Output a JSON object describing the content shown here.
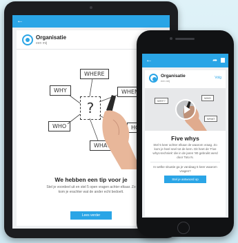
{
  "tablet": {
    "back_icon": "arrow-left-icon",
    "org_name": "Organisatie",
    "org_sub": "een mij",
    "whiteboard": {
      "labels": [
        "WHERE",
        "WHY",
        "WHEN",
        "WHO",
        "HOW",
        "WHAT"
      ],
      "question": "?"
    },
    "title": "We hebben een tip voor je",
    "body": "Stel je voordeel uit en stel 5 open vragen achter elkaar. Zo kom je erachter wat de ander echt bedoelt.",
    "button": "Lees verder"
  },
  "phone": {
    "back_icon": "arrow-left-icon",
    "share_icon": "share-icon",
    "menu_icon": "bookmark-icon",
    "org_name": "Organisatie",
    "org_sub": "een mij",
    "follow": "Volg",
    "video_labels": [
      "WHY?",
      "WHO",
      "WHAT"
    ],
    "title": "Five whys",
    "body": "Stel 5 keer achter elkaar de waarom vraag. Zo kom je heel snel tot de kern. Dit heet de 'Five whys-techniek' die in de jaren '80 gebruikt werd door Toto N.",
    "question": "In welke situatie ga je vandaag 5 keer waarom vragen?",
    "button": "Stel je antwoord op"
  },
  "colors": {
    "accent": "#2aa5e6",
    "background": "#d9eef6"
  }
}
